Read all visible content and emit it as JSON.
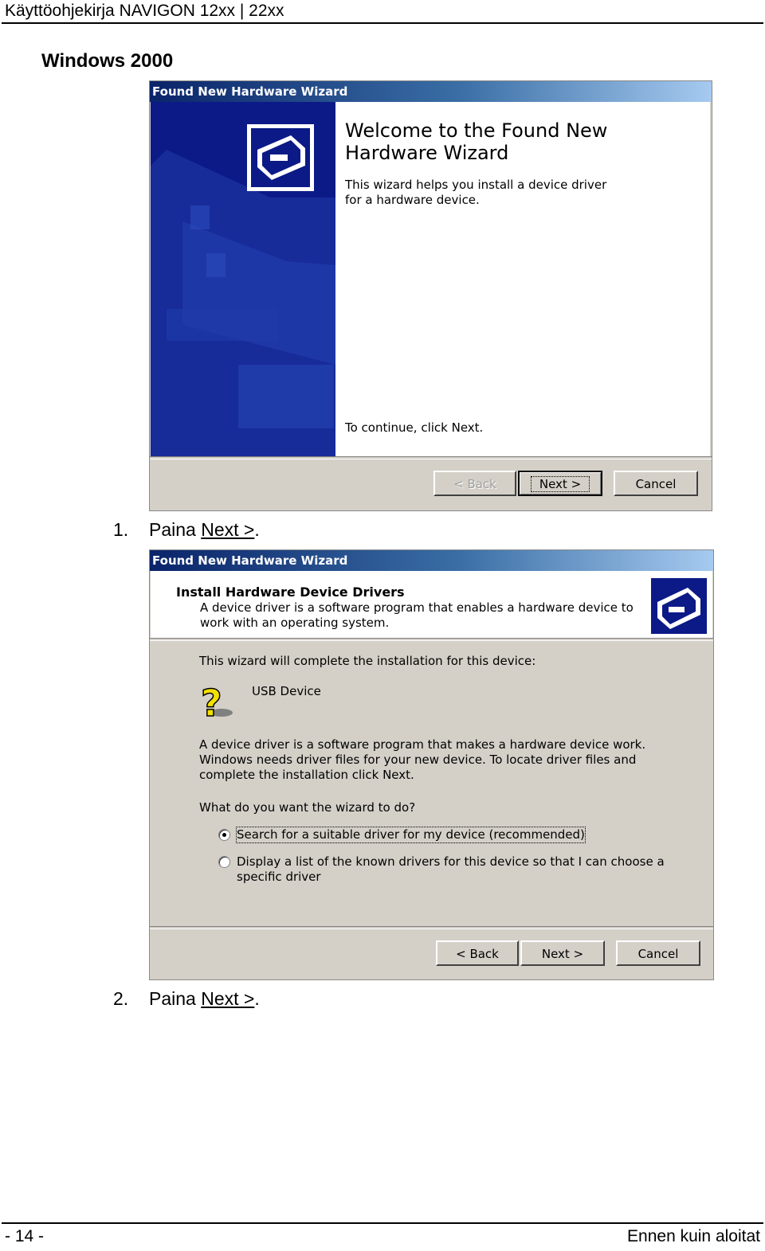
{
  "header": {
    "title": "Käyttöohjekirja NAVIGON 12xx | 22xx"
  },
  "section_title": "Windows 2000",
  "wizard1": {
    "title": "Found New Hardware Wizard",
    "welcome_title": "Welcome to the Found New Hardware Wizard",
    "description": "This wizard helps you install a device driver for a hardware device.",
    "continue_text": "To continue, click Next.",
    "buttons": {
      "back": "< Back",
      "next": "Next >",
      "cancel": "Cancel"
    }
  },
  "steps": [
    {
      "num": "1.",
      "text": "Paina ",
      "link": "Next >",
      "end": "."
    },
    {
      "num": "2.",
      "text": "Paina ",
      "link": "Next >",
      "end": "."
    }
  ],
  "wizard2": {
    "title": "Found New Hardware Wizard",
    "heading": "Install Hardware Device Drivers",
    "subheading": "A device driver is a software program that enables a hardware device to work with an operating system.",
    "intro": "This wizard will complete the installation for this device:",
    "device_name": "USB Device",
    "explanation": "A device driver is a software program that makes a hardware device work. Windows needs driver files for your new device. To locate driver files and complete the installation click Next.",
    "question": "What do you want the wizard to do?",
    "options": [
      {
        "label": "Search for a suitable driver for my device (recommended)",
        "selected": true
      },
      {
        "label": "Display a list of the known drivers for this device so that I can choose a specific driver",
        "selected": false
      }
    ],
    "buttons": {
      "back": "< Back",
      "next": "Next >",
      "cancel": "Cancel"
    }
  },
  "footer": {
    "page": "- 14 -",
    "section": "Ennen kuin aloitat"
  }
}
